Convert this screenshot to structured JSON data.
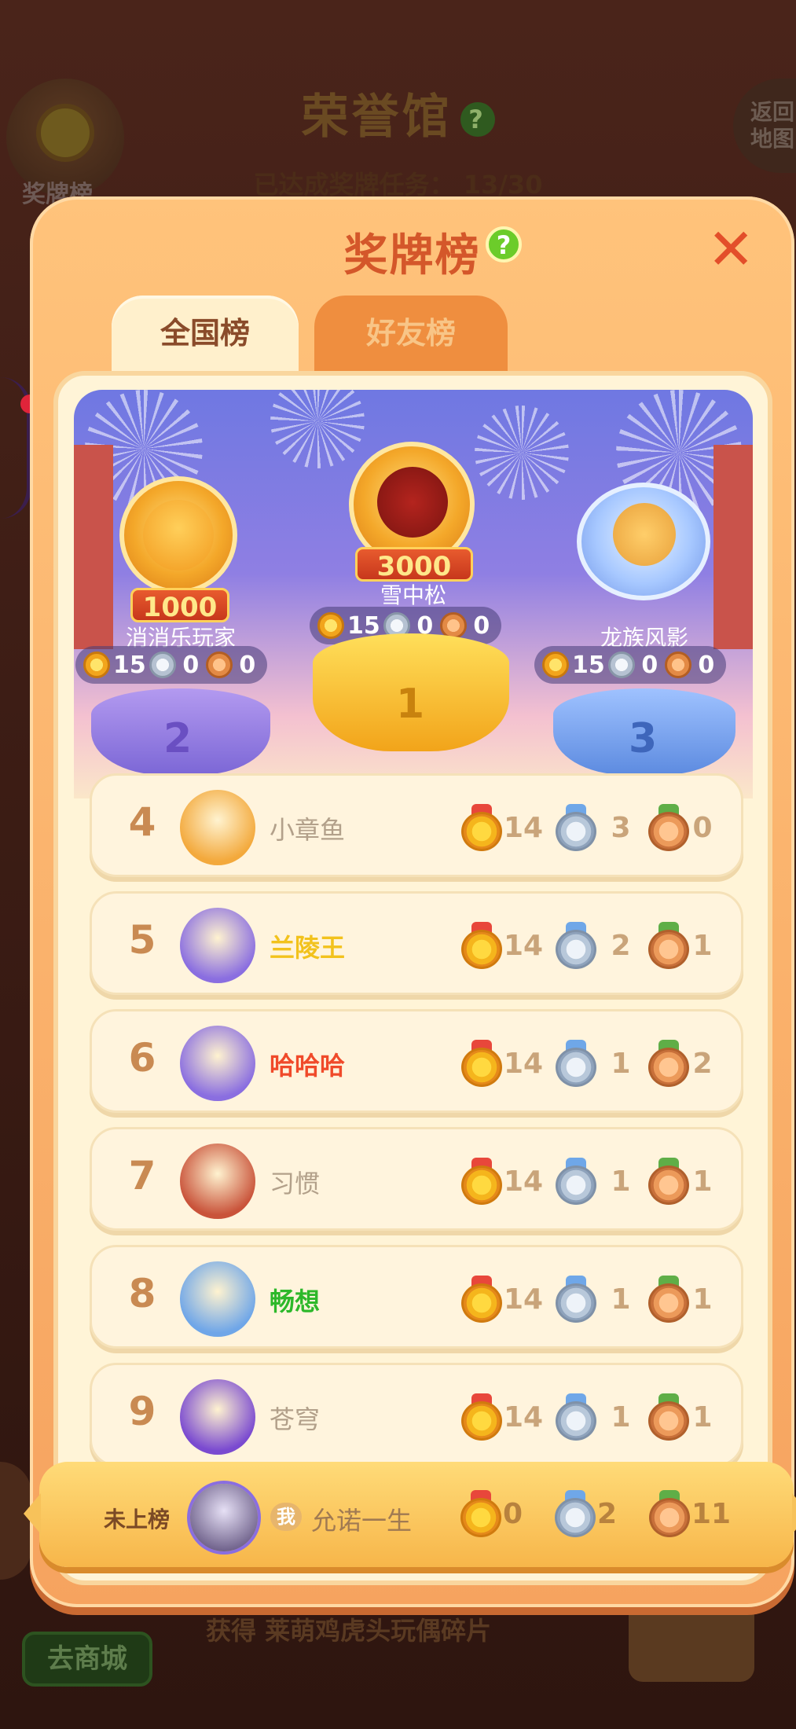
{
  "background": {
    "title": "荣誉馆",
    "progress_label": "已达成奖牌任务：",
    "progress_value": "13/30",
    "medal_button_label": "奖牌榜",
    "back_button_label": "返回地图",
    "bottom_hint_prefix": "获得",
    "bottom_hint_item": "莱萌鸡虎头玩偶碎片",
    "shop_button_label": "去商城"
  },
  "modal": {
    "title": "奖牌榜",
    "help_icon": "question-icon",
    "close_icon": "close-icon",
    "tabs": [
      {
        "label": "全国榜",
        "active": true
      },
      {
        "label": "好友榜",
        "active": false
      }
    ]
  },
  "podium": {
    "first": {
      "rank": "1",
      "name": "雪中松",
      "score_badge": "3000",
      "gold": "15",
      "silver": "0",
      "bronze": "0"
    },
    "second": {
      "rank": "2",
      "name": "消消乐玩家",
      "score_badge": "1000",
      "gold": "15",
      "silver": "0",
      "bronze": "0"
    },
    "third": {
      "rank": "3",
      "name": "龙族风影",
      "gold": "15",
      "silver": "0",
      "bronze": "0"
    }
  },
  "ranking": [
    {
      "rank": "4",
      "name": "小章鱼",
      "name_color": "#b2a08a",
      "gold": "14",
      "silver": "3",
      "bronze": "0"
    },
    {
      "rank": "5",
      "name": "兰陵王",
      "name_color": "#f2c21c",
      "gold": "14",
      "silver": "2",
      "bronze": "1"
    },
    {
      "rank": "6",
      "name": "哈哈哈",
      "name_color": "#f04a2a",
      "gold": "14",
      "silver": "1",
      "bronze": "2"
    },
    {
      "rank": "7",
      "name": "习惯",
      "name_color": "#b2a08a",
      "gold": "14",
      "silver": "1",
      "bronze": "1"
    },
    {
      "rank": "8",
      "name": "畅想",
      "name_color": "#2db82a",
      "gold": "14",
      "silver": "1",
      "bronze": "1"
    },
    {
      "rank": "9",
      "name": "苍穹",
      "name_color": "#b2a08a",
      "gold": "14",
      "silver": "1",
      "bronze": "1"
    }
  ],
  "me": {
    "status": "未上榜",
    "badge": "我",
    "name": "允诺一生",
    "gold": "0",
    "silver": "2",
    "bronze": "11"
  },
  "colors": {
    "modal_bg": "#f6a35f",
    "title": "#d4572a",
    "tab_active_bg": "#fff0cc",
    "tab_inactive_bg": "#ef8e3f",
    "row_bg": "#fff4dd",
    "rank_text": "#c98a52",
    "help_green": "#6ccc2a",
    "close_red": "#e34e2a"
  }
}
